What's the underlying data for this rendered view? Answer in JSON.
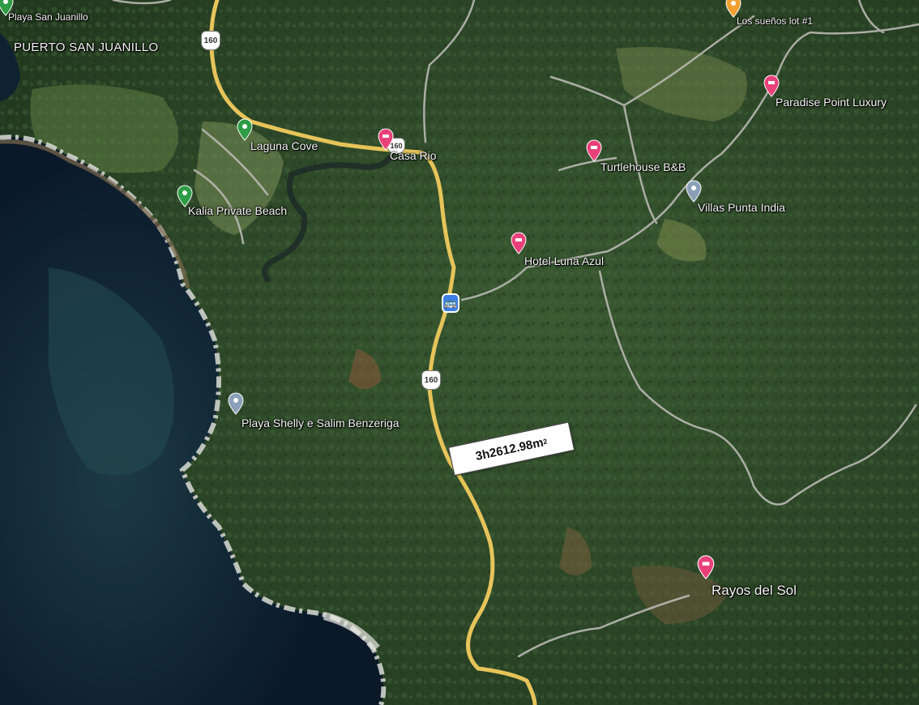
{
  "map": {
    "place_labels": {
      "puerto_san_juanillo": "PUERTO SAN JUANILLO",
      "playa_san_juanillo": "Playa San Juanillo",
      "laguna_cove": "Laguna Cove",
      "casa_rio": "Casa Rio",
      "kalia_private_beach": "Kalia Private Beach",
      "playa_shelly": "Playa Shelly e Salim Benzeriga",
      "los_suenos_lot": "Los sueños lot #1",
      "paradise_point": "Paradise Point Luxury",
      "turtlehouse": "Turtlehouse B&B",
      "villas_punta_india": "Villas Punta India",
      "hotel_luna_azul": "Hotel Luna Azul",
      "rayos_del_sol": "Rayos del Sol"
    },
    "road_shields": [
      "160",
      "160",
      "160"
    ],
    "area_annotation": {
      "value": "3h2612.98m",
      "unit_superscript": "2"
    },
    "icons": {
      "hotel_pin": "hotel-pin-icon",
      "park_pin": "park-pin-icon",
      "poi_pin": "poi-pin-icon",
      "orange_pin": "place-pin-icon",
      "bus": "bus-stop-icon"
    },
    "colors": {
      "ocean": "#0c1a2c",
      "forest": "#2f4a2a",
      "road_main": "#e6c45a",
      "road_minor": "#b9b9b2",
      "hotel_pin": "#e8417a",
      "park_pin": "#2e9b45",
      "poi_pin": "#8aa0b8",
      "orange_pin": "#f0a030",
      "bus": "#3b7ee6"
    }
  }
}
